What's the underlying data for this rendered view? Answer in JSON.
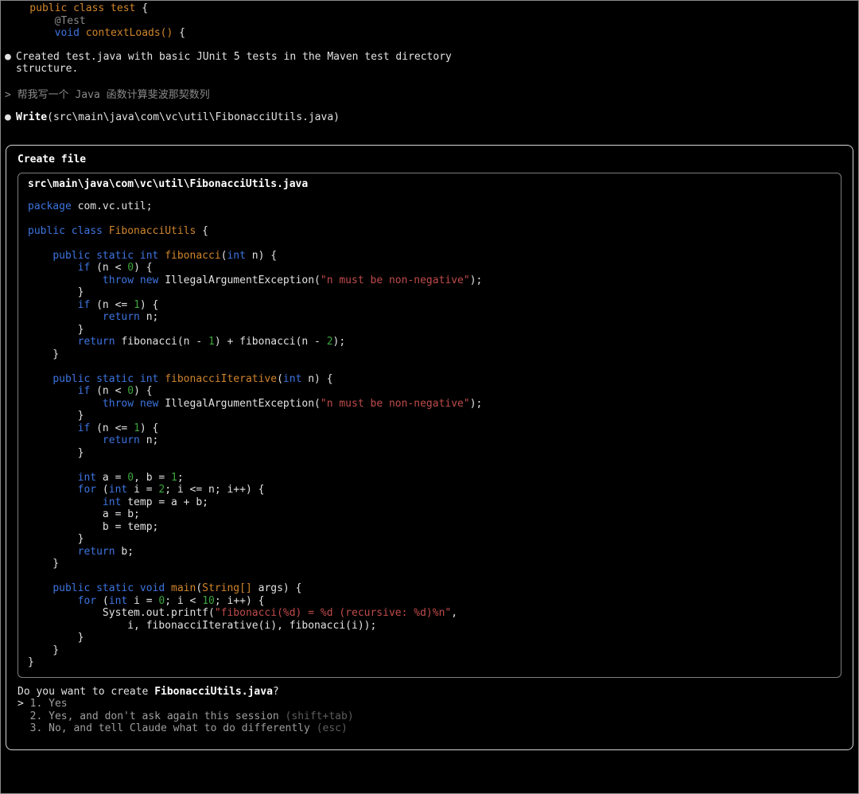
{
  "colors": {
    "background": "#000000",
    "foreground": "#e2e2e2",
    "keyword": "#3d74e0",
    "identifier": "#d0852c",
    "string": "#c04b4b",
    "number": "#3da53d",
    "comment_gray": "#8a8a8a",
    "option_gray": "#9e9e9e",
    "hint_dim": "#5d5d5d",
    "dialog_border": "#d6d6d6",
    "code_border": "#7d7d7d",
    "window_border": "#8a8a8a"
  },
  "snippet": {
    "lines": [
      [
        [
          "f",
          "    public class test "
        ],
        [
          "p",
          "{"
        ]
      ],
      [
        [
          "g",
          "        @Test"
        ]
      ],
      [
        [
          "k",
          "        void"
        ],
        [
          "f",
          " contextLoads()"
        ],
        [
          "p",
          " {"
        ]
      ]
    ]
  },
  "messages": {
    "created": {
      "bullet": "●",
      "text": "Created test.java with basic JUnit 5 tests in the Maven test directory\nstructure."
    },
    "user_prompt": "> 帮我写一个 Java 函数计算斐波那契数列",
    "write": {
      "bullet": "●",
      "tool": "Write",
      "args": "(src\\main\\java\\com\\vc\\util\\FibonacciUtils.java)"
    }
  },
  "dialog": {
    "title": "Create file",
    "file_path": "src\\main\\java\\com\\vc\\util\\FibonacciUtils.java",
    "code_lines": [
      [
        [
          "k",
          "package"
        ],
        [
          "p",
          " com.vc.util;"
        ]
      ],
      [],
      [
        [
          "k",
          "public class "
        ],
        [
          "f",
          "FibonacciUtils"
        ],
        [
          "p",
          " {"
        ]
      ],
      [],
      [
        [
          "p",
          "    "
        ],
        [
          "k",
          "public static int "
        ],
        [
          "f",
          "fibonacci"
        ],
        [
          "p",
          "("
        ],
        [
          "k",
          "int"
        ],
        [
          "p",
          " n) {"
        ]
      ],
      [
        [
          "p",
          "        "
        ],
        [
          "k",
          "if"
        ],
        [
          "p",
          " (n < "
        ],
        [
          "n",
          "0"
        ],
        [
          "p",
          ") {"
        ]
      ],
      [
        [
          "p",
          "            "
        ],
        [
          "k",
          "throw new"
        ],
        [
          "p",
          " IllegalArgumentException("
        ],
        [
          "s",
          "\"n must be non-negative\""
        ],
        [
          "p",
          ");"
        ]
      ],
      [
        [
          "p",
          "        }"
        ]
      ],
      [
        [
          "p",
          "        "
        ],
        [
          "k",
          "if"
        ],
        [
          "p",
          " (n <= "
        ],
        [
          "n",
          "1"
        ],
        [
          "p",
          ") {"
        ]
      ],
      [
        [
          "p",
          "            "
        ],
        [
          "k",
          "return"
        ],
        [
          "p",
          " n;"
        ]
      ],
      [
        [
          "p",
          "        }"
        ]
      ],
      [
        [
          "p",
          "        "
        ],
        [
          "k",
          "return"
        ],
        [
          "p",
          " fibonacci(n - "
        ],
        [
          "n",
          "1"
        ],
        [
          "p",
          ") + fibonacci(n - "
        ],
        [
          "n",
          "2"
        ],
        [
          "p",
          ");"
        ]
      ],
      [
        [
          "p",
          "    }"
        ]
      ],
      [],
      [
        [
          "p",
          "    "
        ],
        [
          "k",
          "public static int "
        ],
        [
          "f",
          "fibonacciIterative"
        ],
        [
          "p",
          "("
        ],
        [
          "k",
          "int"
        ],
        [
          "p",
          " n) {"
        ]
      ],
      [
        [
          "p",
          "        "
        ],
        [
          "k",
          "if"
        ],
        [
          "p",
          " (n < "
        ],
        [
          "n",
          "0"
        ],
        [
          "p",
          ") {"
        ]
      ],
      [
        [
          "p",
          "            "
        ],
        [
          "k",
          "throw new"
        ],
        [
          "p",
          " IllegalArgumentException("
        ],
        [
          "s",
          "\"n must be non-negative\""
        ],
        [
          "p",
          ");"
        ]
      ],
      [
        [
          "p",
          "        }"
        ]
      ],
      [
        [
          "p",
          "        "
        ],
        [
          "k",
          "if"
        ],
        [
          "p",
          " (n <= "
        ],
        [
          "n",
          "1"
        ],
        [
          "p",
          ") {"
        ]
      ],
      [
        [
          "p",
          "            "
        ],
        [
          "k",
          "return"
        ],
        [
          "p",
          " n;"
        ]
      ],
      [
        [
          "p",
          "        }"
        ]
      ],
      [],
      [
        [
          "p",
          "        "
        ],
        [
          "k",
          "int"
        ],
        [
          "p",
          " a = "
        ],
        [
          "n",
          "0"
        ],
        [
          "p",
          ", b = "
        ],
        [
          "n",
          "1"
        ],
        [
          "p",
          ";"
        ]
      ],
      [
        [
          "p",
          "        "
        ],
        [
          "k",
          "for"
        ],
        [
          "p",
          " ("
        ],
        [
          "k",
          "int"
        ],
        [
          "p",
          " i = "
        ],
        [
          "n",
          "2"
        ],
        [
          "p",
          "; i <= n; i++) {"
        ]
      ],
      [
        [
          "p",
          "            "
        ],
        [
          "k",
          "int"
        ],
        [
          "p",
          " temp = a + b;"
        ]
      ],
      [
        [
          "p",
          "            a = b;"
        ]
      ],
      [
        [
          "p",
          "            b = temp;"
        ]
      ],
      [
        [
          "p",
          "        }"
        ]
      ],
      [
        [
          "p",
          "        "
        ],
        [
          "k",
          "return"
        ],
        [
          "p",
          " b;"
        ]
      ],
      [
        [
          "p",
          "    }"
        ]
      ],
      [],
      [
        [
          "p",
          "    "
        ],
        [
          "k",
          "public static void "
        ],
        [
          "f",
          "main"
        ],
        [
          "p",
          "("
        ],
        [
          "f",
          "String[]"
        ],
        [
          "p",
          " args) {"
        ]
      ],
      [
        [
          "p",
          "        "
        ],
        [
          "k",
          "for"
        ],
        [
          "p",
          " ("
        ],
        [
          "k",
          "int"
        ],
        [
          "p",
          " i = "
        ],
        [
          "n",
          "0"
        ],
        [
          "p",
          "; i < "
        ],
        [
          "n",
          "10"
        ],
        [
          "p",
          "; i++) {"
        ]
      ],
      [
        [
          "p",
          "            System.out.printf("
        ],
        [
          "s",
          "\"fibonacci(%d) = %d (recursive: %d)%n\""
        ],
        [
          "p",
          ","
        ]
      ],
      [
        [
          "p",
          "                i, fibonacciIterative(i), fibonacci(i));"
        ]
      ],
      [
        [
          "p",
          "        }"
        ]
      ],
      [
        [
          "p",
          "    }"
        ]
      ],
      [
        [
          "p",
          "}"
        ]
      ]
    ],
    "question": [
      [
        "p",
        "Do you want to create "
      ],
      [
        "b",
        "FibonacciUtils.java"
      ],
      [
        "p",
        "?"
      ]
    ],
    "options": [
      [
        [
          "p",
          "> "
        ],
        [
          "o",
          "1. Yes"
        ]
      ],
      [
        [
          "o",
          "  2. Yes, and don't ask again this session "
        ],
        [
          "d",
          "(shift+tab)"
        ]
      ],
      [
        [
          "o",
          "  3. No, and tell Claude what to do differently "
        ],
        [
          "d",
          "(esc)"
        ]
      ]
    ]
  }
}
